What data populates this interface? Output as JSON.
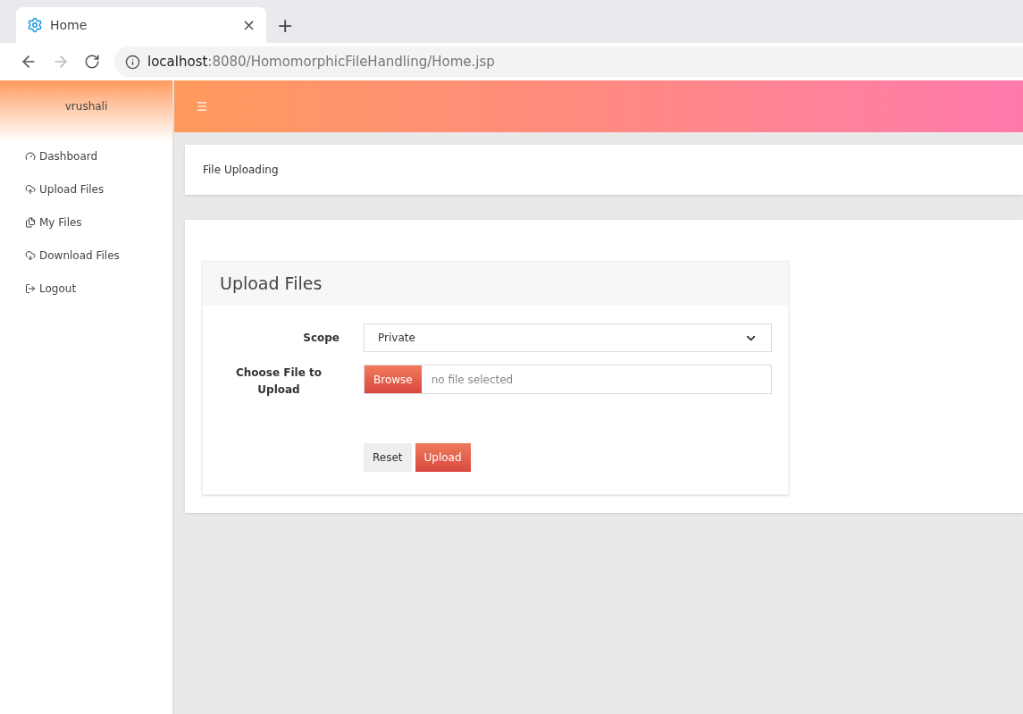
{
  "browser": {
    "tab": {
      "title": "Home",
      "close": "×"
    },
    "new_tab": "+",
    "url_host": "localhost",
    "url_path": ":8080/HomomorphicFileHandling/Home.jsp"
  },
  "sidebar": {
    "user": "vrushali",
    "items": [
      {
        "label": "Dashboard"
      },
      {
        "label": "Upload Files"
      },
      {
        "label": "My Files"
      },
      {
        "label": "Download Files"
      },
      {
        "label": "Logout"
      }
    ]
  },
  "breadcrumb": "File Uploading",
  "panel": {
    "title": "Upload Files",
    "scope": {
      "label": "Scope",
      "value": "Private"
    },
    "file": {
      "label": "Choose File to Upload",
      "button": "Browse",
      "placeholder": "no file selected"
    },
    "buttons": [
      "Reset",
      "Upload"
    ]
  }
}
